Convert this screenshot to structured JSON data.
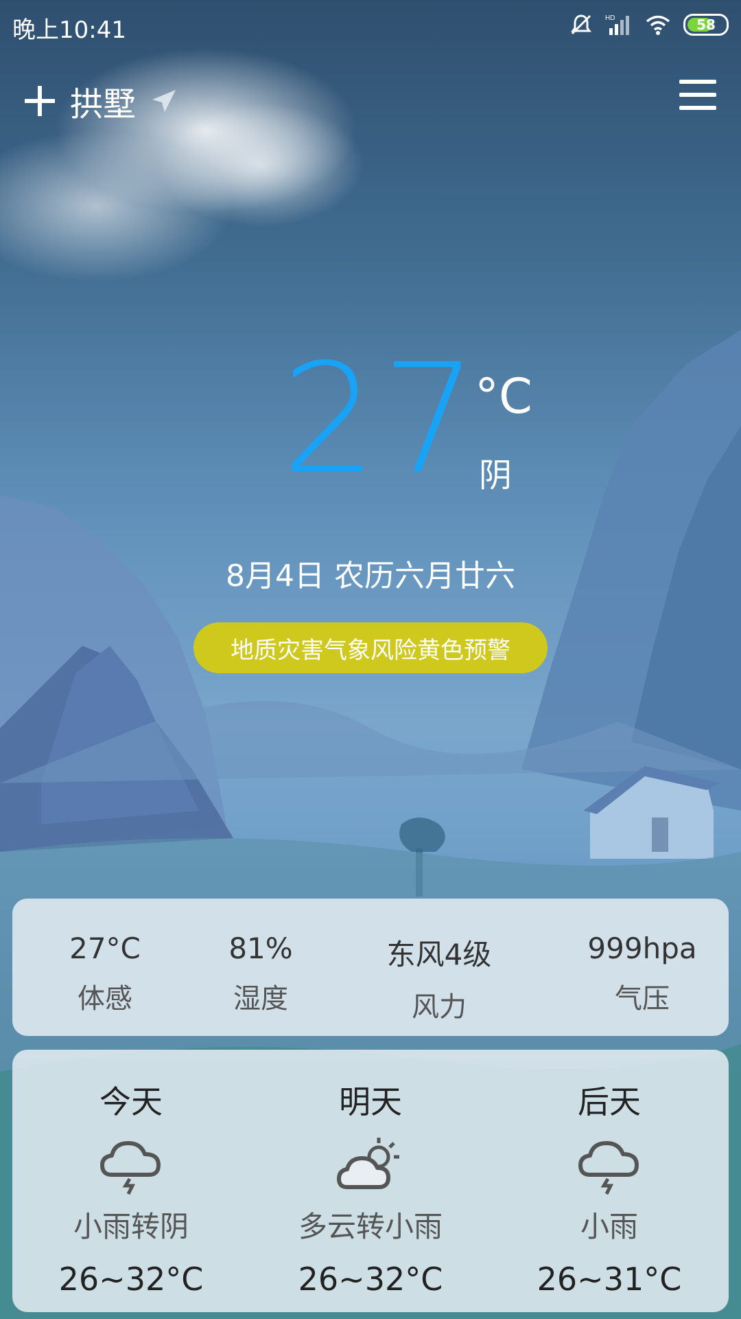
{
  "status": {
    "time": "晚上10:41",
    "battery": "58",
    "icons": [
      "mute-icon",
      "hd-signal-icon",
      "wifi-icon",
      "battery-icon"
    ]
  },
  "header": {
    "city": "拱墅",
    "add_icon": "plus-icon",
    "location_icon": "location-arrow-icon",
    "menu_icon": "hamburger-menu-icon"
  },
  "current": {
    "temp": "27",
    "unit": "°C",
    "condition": "阴",
    "date": "8月4日 农历六月廿六",
    "alert": "地质灾害气象风险黄色预警"
  },
  "details": [
    {
      "value": "27°C",
      "label": "体感"
    },
    {
      "value": "81%",
      "label": "湿度"
    },
    {
      "value": "东风4级",
      "label": "风力"
    },
    {
      "value": "999hpa",
      "label": "气压"
    }
  ],
  "forecast": [
    {
      "day": "今天",
      "icon": "rain-cloud-icon",
      "condition": "小雨转阴",
      "temp": "26~32°C"
    },
    {
      "day": "明天",
      "icon": "partly-cloudy-icon",
      "condition": "多云转小雨",
      "temp": "26~32°C"
    },
    {
      "day": "后天",
      "icon": "rain-cloud-icon",
      "condition": "小雨",
      "temp": "26~31°C"
    }
  ],
  "colors": {
    "temp_accent": "#18a3f6",
    "alert_bg": "#cfc81d",
    "battery_fill": "#7bd53c"
  }
}
